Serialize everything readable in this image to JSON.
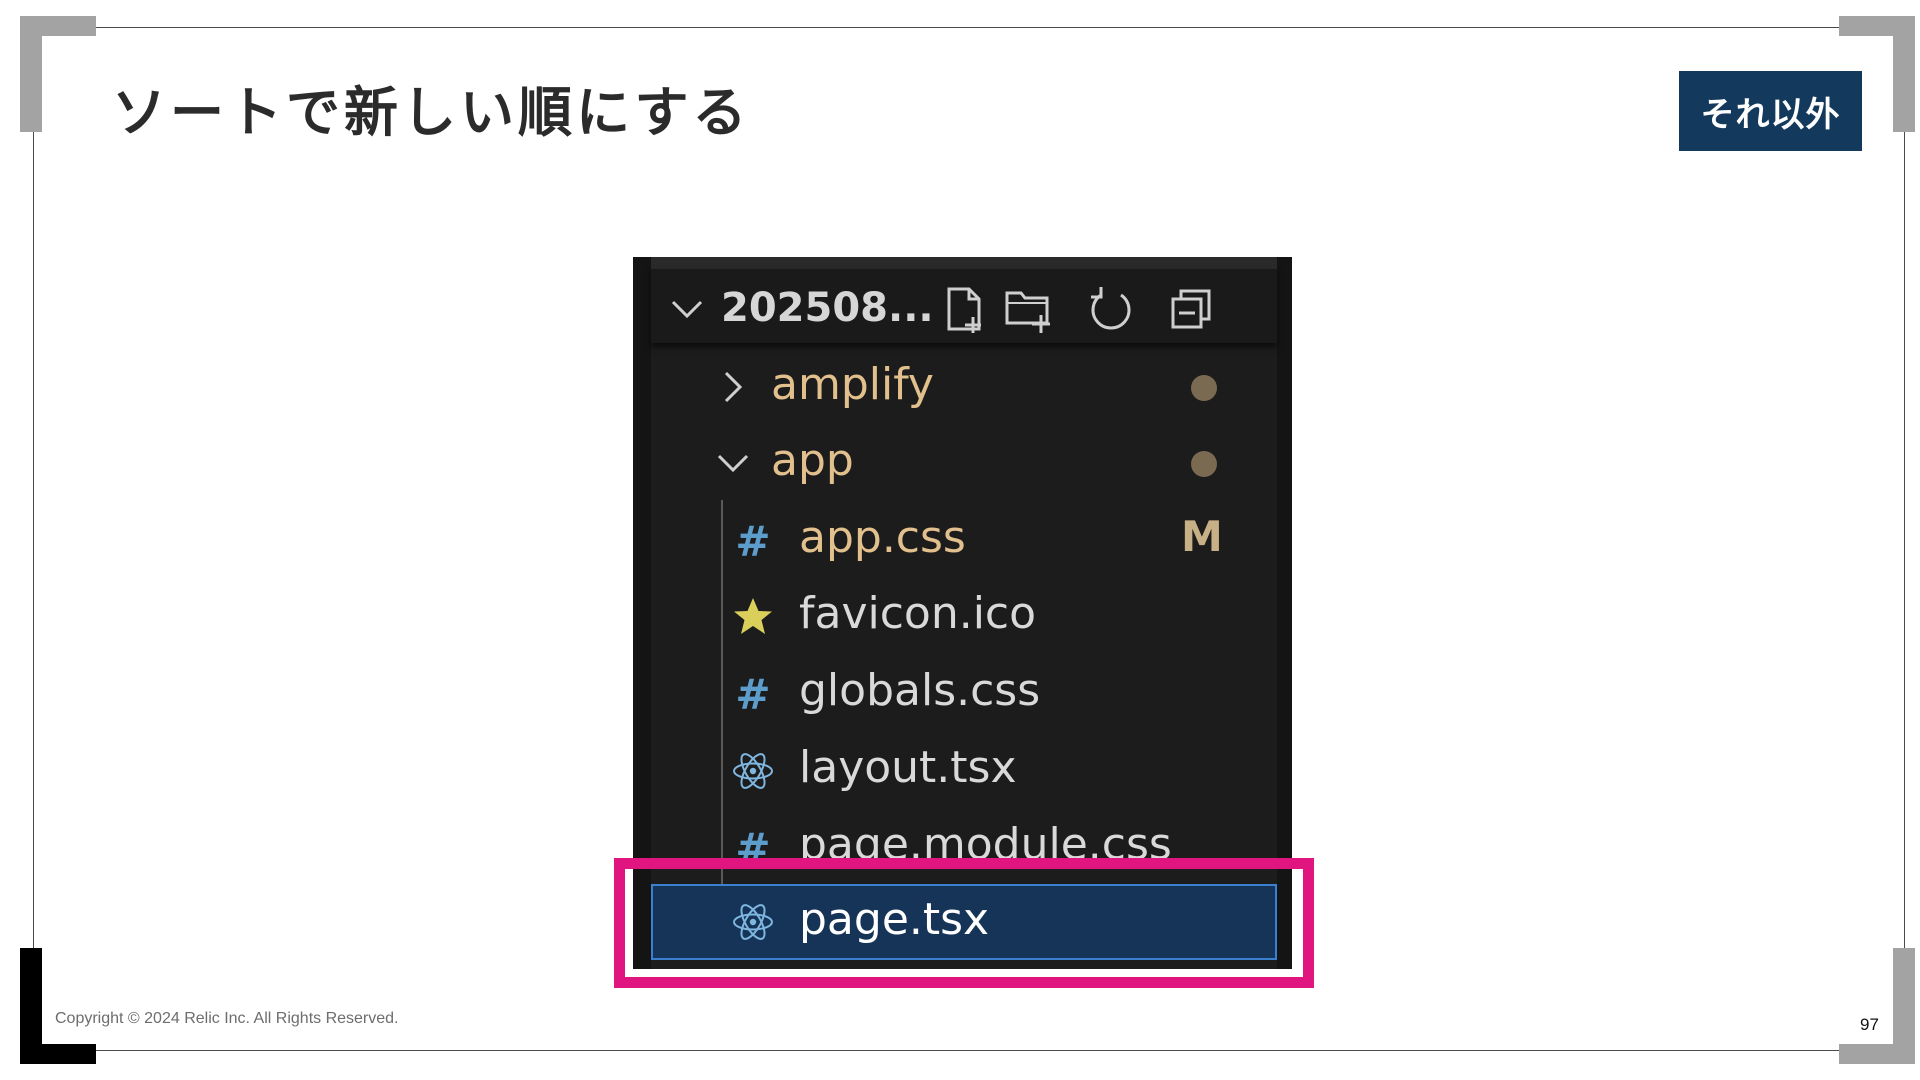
{
  "slide": {
    "title": "ソートで新しい順にする",
    "badge": "それ以外",
    "copyright": "Copyright © 2024 Relic Inc. All Rights Reserved.",
    "page_number": "97"
  },
  "explorer": {
    "header_title": "202508...",
    "header_icons": [
      "new-file-icon",
      "new-folder-icon",
      "refresh-icon",
      "collapse-all-icon"
    ],
    "items": [
      {
        "label": "amplify",
        "type": "folder",
        "expanded": false,
        "status": "dot"
      },
      {
        "label": "app",
        "type": "folder",
        "expanded": true,
        "status": "dot"
      },
      {
        "label": "app.css",
        "type": "css",
        "status": "M"
      },
      {
        "label": "favicon.ico",
        "type": "ico",
        "status": ""
      },
      {
        "label": "globals.css",
        "type": "css",
        "status": ""
      },
      {
        "label": "layout.tsx",
        "type": "react",
        "status": ""
      },
      {
        "label": "page.module.css",
        "type": "css",
        "status": ""
      },
      {
        "label": "page.tsx",
        "type": "react",
        "status": "",
        "selected": true
      }
    ],
    "colors": {
      "folder_text": "#e2c08d",
      "file_text": "#d9d9d9",
      "css_icon": "#5d9dcc",
      "react_icon": "#7fb6e0",
      "star_icon": "#d9cf5a",
      "selection_bg": "#163457",
      "highlight": "#e0157f"
    }
  }
}
